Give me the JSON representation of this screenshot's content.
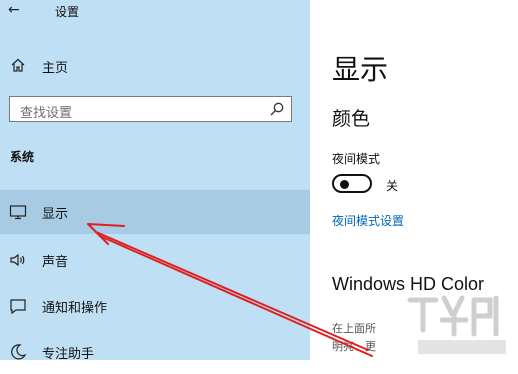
{
  "window": {
    "title": "设置",
    "back_icon": "back-arrow-icon"
  },
  "sidebar": {
    "home_label": "主页",
    "search_placeholder": "查找设置",
    "section_label": "系统",
    "items": [
      {
        "label": "显示",
        "icon": "monitor-icon",
        "active": true
      },
      {
        "label": "声音",
        "icon": "speaker-icon",
        "active": false
      },
      {
        "label": "通知和操作",
        "icon": "notification-icon",
        "active": false
      },
      {
        "label": "专注助手",
        "icon": "moon-icon",
        "active": false
      }
    ]
  },
  "main": {
    "page_title": "显示",
    "color_heading": "颜色",
    "night_mode_label": "夜间模式",
    "night_mode_state": "关",
    "night_mode_settings_link": "夜间模式设置",
    "hdr_heading": "Windows HD Color",
    "hdr_desc_line1": "在上面所",
    "hdr_desc_line2": "明亮、更"
  },
  "colors": {
    "sidebar_bg": "#bfe0f4",
    "active_item_bg": "#a7cbe2",
    "link": "#0067b8",
    "annotation_arrow": "#e02020"
  }
}
